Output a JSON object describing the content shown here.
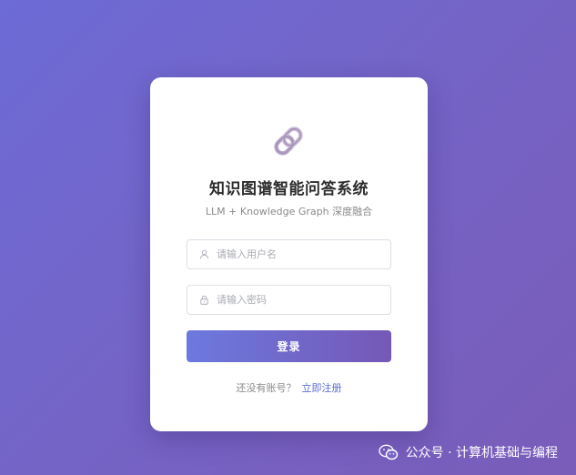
{
  "login": {
    "logo_icon": "link-chain-icon",
    "title": "知识图谱智能问答系统",
    "subtitle": "LLM + Knowledge Graph 深度融合",
    "username_placeholder": "请输入用户名",
    "password_placeholder": "请输入密码",
    "login_label": "登录",
    "no_account_text": "还没有账号？",
    "register_link": "立即注册"
  },
  "watermark": {
    "icon": "wechat-icon",
    "text": "公众号 · 计算机基础与编程"
  },
  "colors": {
    "background_start": "#6d6bd6",
    "background_end": "#7a5cb9",
    "button_start": "#6c79de",
    "button_end": "#7558b6",
    "link": "#5b6fd0"
  }
}
